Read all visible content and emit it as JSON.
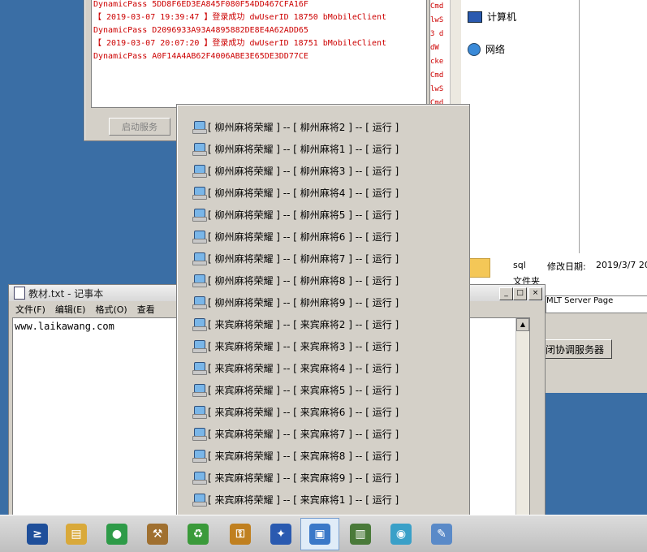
{
  "log": {
    "lines": [
      "DynamicPass 5DD8F6ED3EA845F080F54DD467CFA16F",
      "【 2019-03-07 19:39:47 】登录成功 dwUserID 18750 bMobileClient",
      "DynamicPass D2096933A93A4895882DE8E4A62ADD65",
      "【 2019-03-07 20:07:20 】登录成功 dwUserID 18751 bMobileClient",
      "DynamicPass A0F14A4AB62F4006ABE3E65DE3DD77CE"
    ],
    "start_button": "启动服务"
  },
  "side_strip": [
    "Cmd",
    "lwS",
    "3 d",
    "dW",
    "",
    "cke",
    "Cmd",
    "lwS",
    "Cmd"
  ],
  "explorer": {
    "items": [
      {
        "label": "计算机"
      },
      {
        "label": "网络"
      }
    ]
  },
  "file_row": {
    "name": "sql",
    "date_label": "修改日期:",
    "date_value": "2019/3/7 20",
    "type_label": "文件夹"
  },
  "service": {
    "field_text": "MLT Server Page",
    "coord_button": "闭协调服务器"
  },
  "notepad": {
    "title": "教材.txt - 记事本",
    "menu": [
      "文件(F)",
      "编辑(E)",
      "格式(O)",
      "查看"
    ],
    "content": "www.laikawang.com",
    "controls": {
      "minimize": "_",
      "maximize": "□",
      "close": "×"
    }
  },
  "popup": {
    "items": [
      "[ 柳州麻将荣耀 ] -- [ 柳州麻将2 ] -- [ 运行 ]",
      "[ 柳州麻将荣耀 ] -- [ 柳州麻将1 ] -- [ 运行 ]",
      "[ 柳州麻将荣耀 ] -- [ 柳州麻将3 ] -- [ 运行 ]",
      "[ 柳州麻将荣耀 ] -- [ 柳州麻将4 ] -- [ 运行 ]",
      "[ 柳州麻将荣耀 ] -- [ 柳州麻将5 ] -- [ 运行 ]",
      "[ 柳州麻将荣耀 ] -- [ 柳州麻将6 ] -- [ 运行 ]",
      "[ 柳州麻将荣耀 ] -- [ 柳州麻将7 ] -- [ 运行 ]",
      "[ 柳州麻将荣耀 ] -- [ 柳州麻将8 ] -- [ 运行 ]",
      "[ 柳州麻将荣耀 ] -- [ 柳州麻将9 ] -- [ 运行 ]",
      "[ 来宾麻将荣耀 ] -- [ 来宾麻将2 ] -- [ 运行 ]",
      "[ 来宾麻将荣耀 ] -- [ 来宾麻将3 ] -- [ 运行 ]",
      "[ 来宾麻将荣耀 ] -- [ 来宾麻将4 ] -- [ 运行 ]",
      "[ 来宾麻将荣耀 ] -- [ 来宾麻将5 ] -- [ 运行 ]",
      "[ 来宾麻将荣耀 ] -- [ 来宾麻将6 ] -- [ 运行 ]",
      "[ 来宾麻将荣耀 ] -- [ 来宾麻将7 ] -- [ 运行 ]",
      "[ 来宾麻将荣耀 ] -- [ 来宾麻将8 ] -- [ 运行 ]",
      "[ 来宾麻将荣耀 ] -- [ 来宾麻将9 ] -- [ 运行 ]",
      "[ 来宾麻将荣耀 ] -- [ 来宾麻将1 ] -- [ 运行 ]"
    ]
  },
  "taskbar": {
    "buttons": [
      {
        "icon": "powershell-icon",
        "glyph": "≥",
        "color": "#1f4f9a"
      },
      {
        "icon": "explorer-icon",
        "glyph": "▤",
        "color": "#d9a93a"
      },
      {
        "icon": "chrome-icon",
        "glyph": "●",
        "color": "#2e9b48"
      },
      {
        "icon": "tools-icon",
        "glyph": "⚒",
        "color": "#a07030"
      },
      {
        "icon": "recycle-icon",
        "glyph": "♻",
        "color": "#3a9a3a"
      },
      {
        "icon": "key-icon",
        "glyph": "⚿",
        "color": "#c08020"
      },
      {
        "icon": "compass-icon",
        "glyph": "✦",
        "color": "#2a5ab0"
      },
      {
        "icon": "network-computer-icon",
        "glyph": "▣",
        "color": "#3a78c8"
      },
      {
        "icon": "server-icon",
        "glyph": "▥",
        "color": "#4a7a3a"
      },
      {
        "icon": "chat-icon",
        "glyph": "◉",
        "color": "#3aa0c8"
      },
      {
        "icon": "notepad-icon",
        "glyph": "✎",
        "color": "#5a8ac8"
      }
    ]
  }
}
